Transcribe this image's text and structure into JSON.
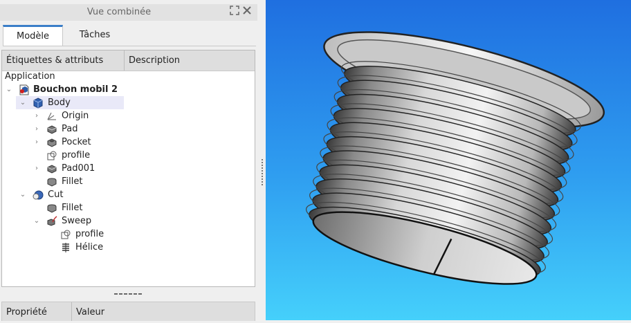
{
  "panel": {
    "title": "Vue combinée",
    "tabs": [
      "Modèle",
      "Tâches"
    ],
    "tree_headers": [
      "Étiquettes & attributs",
      "Description"
    ],
    "section": "Application",
    "property_headers": [
      "Propriété",
      "Valeur"
    ]
  },
  "tree": {
    "document": "Bouchon mobil 2",
    "body": "Body",
    "origin": "Origin",
    "pad": "Pad",
    "pocket": "Pocket",
    "profile": "profile",
    "pad001": "Pad001",
    "fillet": "Fillet",
    "cut": "Cut",
    "cut_fillet": "Fillet",
    "sweep": "Sweep",
    "sweep_profile": "profile",
    "helix": "Hélice"
  },
  "colors": {
    "accent": "#3a7ec8",
    "view_top": "#1f6fe0",
    "view_bottom": "#45d0fb"
  }
}
